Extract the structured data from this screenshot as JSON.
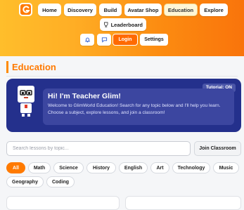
{
  "header": {
    "nav": [
      "Home",
      "Discovery",
      "Build",
      "Avatar Shop",
      "Education",
      "Explore",
      "Leaderboard"
    ],
    "active_nav": "Education",
    "login_label": "Login",
    "settings_label": "Settings",
    "colors": {
      "accent": "#ff7a00",
      "gradient_start": "#ffbe2b",
      "gradient_end": "#f9740b"
    }
  },
  "page": {
    "title": "Education"
  },
  "tutor": {
    "badge": "Tutorial: ON",
    "heading": "Hi! I'm Teacher Glim!",
    "body": "Welcome to GlimWorld Education! Search for any topic below and I'll help you learn. Choose a subject, explore lessons, and join a classroom!",
    "card_color": "#24308c"
  },
  "search": {
    "placeholder": "Search lessons by topic...",
    "value": ""
  },
  "join_label": "Join Classroom",
  "subjects": [
    "All",
    "Math",
    "Science",
    "History",
    "English",
    "Art",
    "Technology",
    "Music",
    "Geography",
    "Coding"
  ],
  "active_subject": "All"
}
